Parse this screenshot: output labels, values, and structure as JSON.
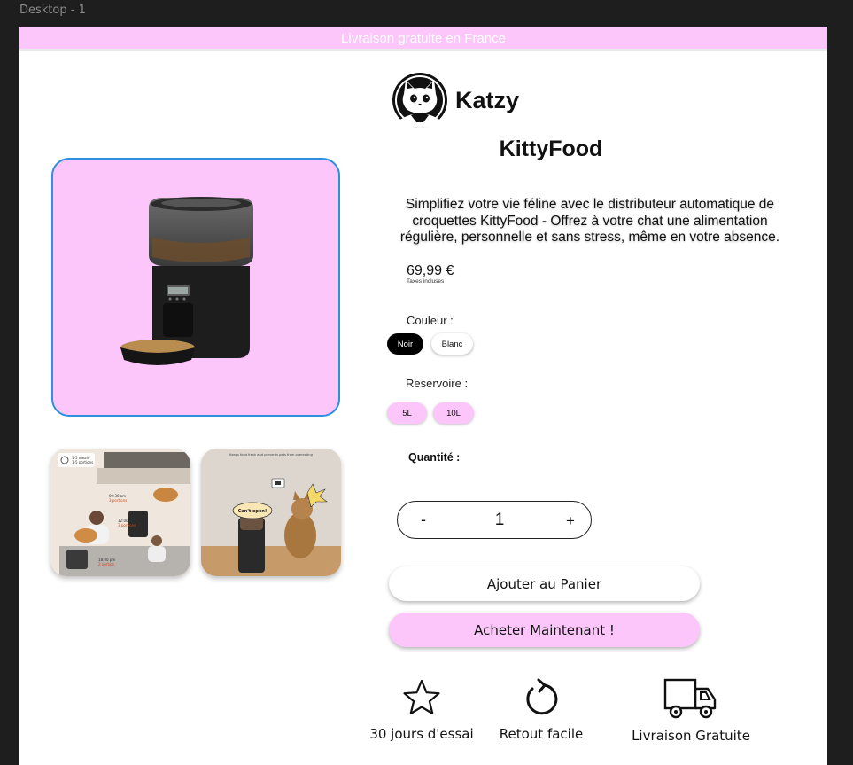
{
  "canvas": {
    "frame_label": "Desktop - 1"
  },
  "banner": {
    "text": "Livraison gratuite en France"
  },
  "brand": {
    "name": "Katzy"
  },
  "product": {
    "title": "KittyFood",
    "description": "Simplifiez votre vie féline avec le distributeur automatique de croquettes KittyFood - Offrez à votre chat une alimentation régulière, personnelle et sans stress, même en votre absence.",
    "price": "69,99 €",
    "tax_note": "Taxes incluses"
  },
  "options": {
    "color": {
      "label": "Couleur :",
      "choices": [
        "Noir",
        "Blanc"
      ],
      "selected": "Noir"
    },
    "reservoir": {
      "label": "Reservoire :",
      "choices": [
        "5L",
        "10L"
      ]
    }
  },
  "quantity": {
    "label": "Quantité :",
    "minus": "-",
    "value": "1",
    "plus": "+"
  },
  "actions": {
    "add_to_cart": "Ajouter au Panier",
    "buy_now": "Acheter Maintenant !"
  },
  "thumbnails": {
    "first": {
      "badge_line1": "1-5 meals",
      "badge_line2": "1-5 portions",
      "t1": "09:30 am",
      "p1": "3 portions",
      "t2": "12:00 am",
      "p2": "3 portions",
      "t3": "18:00 pm",
      "p3": "2 portion"
    },
    "second": {
      "caption": "Keeps food fresh and prevents pets from overeating",
      "bubble": "Can't open!"
    }
  },
  "features": [
    {
      "icon": "star-icon",
      "label": "30 jours d'essai"
    },
    {
      "icon": "refresh-icon",
      "label": "Retout facile"
    },
    {
      "icon": "truck-icon",
      "label": "Livraison Gratuite"
    }
  ]
}
